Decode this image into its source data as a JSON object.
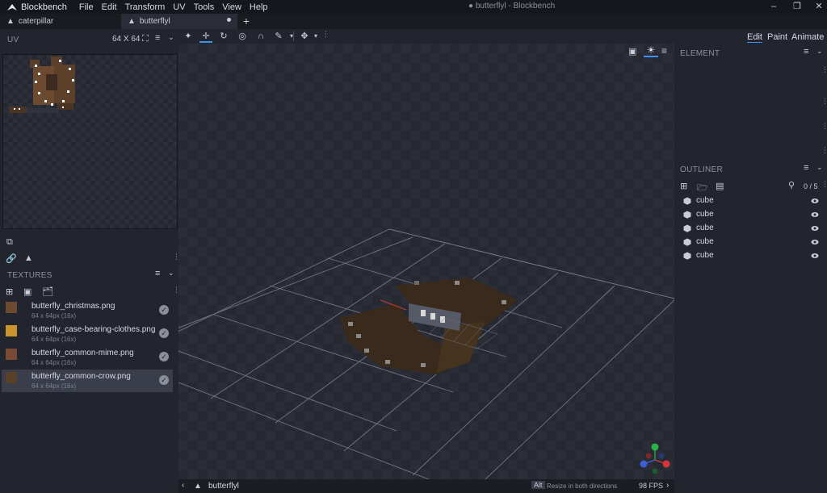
{
  "app": {
    "name": "Blockbench",
    "window_title": "● butterflyl - Blockbench"
  },
  "menu": [
    "File",
    "Edit",
    "Transform",
    "UV",
    "Tools",
    "View",
    "Help"
  ],
  "tabs": [
    {
      "label": "caterpillar",
      "active": false
    },
    {
      "label": "butterflyl",
      "active": true
    }
  ],
  "uv": {
    "title": "UV",
    "size": "64 X 64"
  },
  "textures": {
    "title": "TEXTURES",
    "items": [
      {
        "name": "butterfly_christmas.png",
        "size": "64 x 64px (16x)",
        "selected": false
      },
      {
        "name": "butterfly_case-bearing-clothes.png",
        "size": "64 x 64px (16x)",
        "selected": false
      },
      {
        "name": "butterfly_common-mime.png",
        "size": "64 x 64px (16x)",
        "selected": false
      },
      {
        "name": "butterfly_common-crow.png",
        "size": "64 x 64px (16x)",
        "selected": true
      }
    ]
  },
  "modes": [
    "Edit",
    "Paint",
    "Animate"
  ],
  "active_mode": "Edit",
  "element_panel": {
    "title": "ELEMENT"
  },
  "outliner": {
    "title": "OUTLINER",
    "count": "0 / 5",
    "items": [
      "cube",
      "cube",
      "cube",
      "cube",
      "cube"
    ]
  },
  "status": {
    "model_name": "butterflyl",
    "key_hint": "Alt",
    "hint": "Resize in both directions",
    "fps": "98 FPS"
  },
  "colors": {
    "accent": "#3e90ff",
    "background": "#1f2128",
    "panel": "#22252d"
  }
}
